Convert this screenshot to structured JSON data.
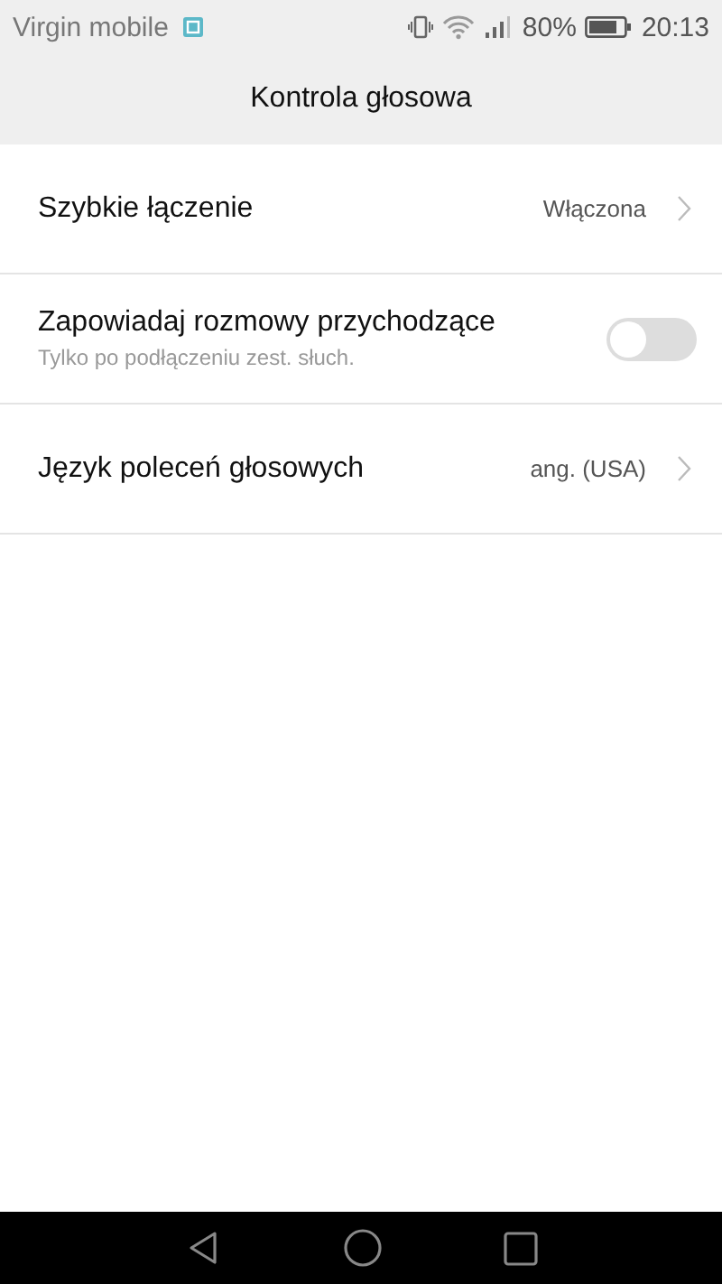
{
  "status_bar": {
    "carrier": "Virgin mobile",
    "battery": "80%",
    "time": "20:13"
  },
  "header": {
    "title": "Kontrola głosowa"
  },
  "settings": [
    {
      "kind": "link",
      "label": "Szybkie łączenie",
      "value": "Włączona"
    },
    {
      "kind": "switch",
      "label": "Zapowiadaj rozmowy przychodzące",
      "summary": "Tylko po podłączeniu zest. słuch.",
      "on": false
    },
    {
      "kind": "link",
      "label": "Język poleceń głosowych",
      "value": "ang. (USA)"
    }
  ]
}
